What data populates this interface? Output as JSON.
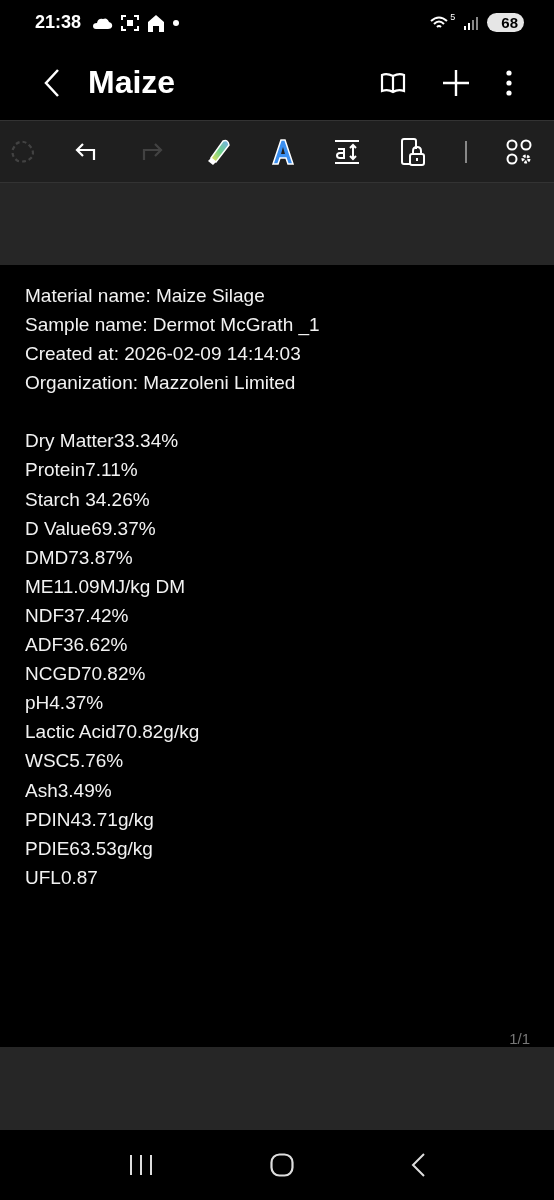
{
  "status_bar": {
    "time": "21:38",
    "network_badge": "5",
    "battery": "68"
  },
  "header": {
    "title": "Maize"
  },
  "toolbar": [
    {
      "kind": "lasso",
      "disabled": true
    },
    {
      "kind": "undo",
      "disabled": false
    },
    {
      "kind": "redo",
      "disabled": true
    },
    {
      "kind": "pen",
      "disabled": false
    },
    {
      "kind": "text",
      "disabled": false
    },
    {
      "kind": "spacing",
      "disabled": false
    },
    {
      "kind": "lock",
      "disabled": false
    },
    {
      "kind": "apps",
      "disabled": false
    }
  ],
  "note": {
    "details": [
      "Material name: Maize Silage",
      "Sample name: Dermot McGrath _1",
      "Created at: 2026-02-09 14:14:03",
      "Organization: Mazzoleni Limited"
    ],
    "results": [
      "Dry Matter33.34%",
      "Protein7.11%",
      "Starch 34.26%",
      "D Value69.37%",
      "DMD73.87%",
      "ME11.09MJ/kg DM",
      "NDF37.42%",
      "ADF36.62%",
      "NCGD70.82%",
      "pH4.37%",
      "Lactic Acid70.82g/kg",
      "WSC5.76%",
      "Ash3.49%",
      "PDIN43.71g/kg",
      "PDIE63.53g/kg",
      "UFL0.87"
    ],
    "page_indicator": "1/1"
  }
}
